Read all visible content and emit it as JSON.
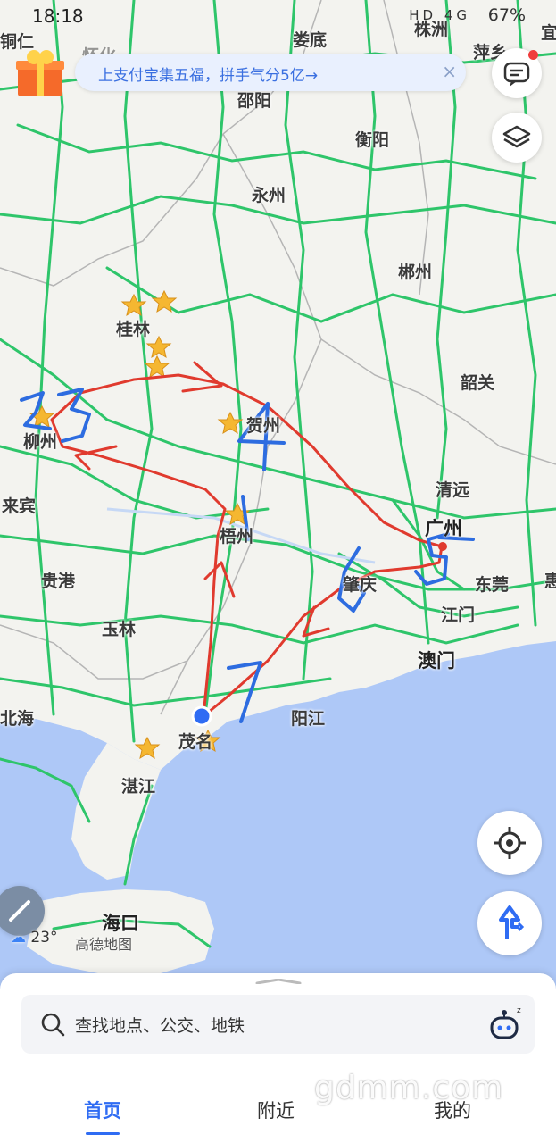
{
  "status_bar": {
    "time": "18:18",
    "network": "HD  4G",
    "battery": "67%"
  },
  "banner": {
    "text": "上支付宝集五福，拼手气分5亿→",
    "close": "×"
  },
  "cities": [
    {
      "id": "tongren",
      "name": "铜仁"
    },
    {
      "id": "huaihua",
      "name": "怀化"
    },
    {
      "id": "loudi",
      "name": "娄底"
    },
    {
      "id": "zhuzhou",
      "name": "株洲"
    },
    {
      "id": "pingxiang",
      "name": "萍乡"
    },
    {
      "id": "yichun",
      "name": "宜"
    },
    {
      "id": "shaoyang",
      "name": "邵阳"
    },
    {
      "id": "hengyang",
      "name": "衡阳"
    },
    {
      "id": "yongzhou",
      "name": "永州"
    },
    {
      "id": "chenzhou",
      "name": "郴州"
    },
    {
      "id": "guilin",
      "name": "桂林"
    },
    {
      "id": "shaoguan",
      "name": "韶关"
    },
    {
      "id": "liuzhou",
      "name": "柳州"
    },
    {
      "id": "hezhou",
      "name": "贺州"
    },
    {
      "id": "qingyuan",
      "name": "清远"
    },
    {
      "id": "laibin",
      "name": "来宾"
    },
    {
      "id": "guangzhou",
      "name": "广州"
    },
    {
      "id": "wuzhou",
      "name": "梧州"
    },
    {
      "id": "zhaoqing",
      "name": "肇庆"
    },
    {
      "id": "dongguan",
      "name": "东莞"
    },
    {
      "id": "hui",
      "name": "惠"
    },
    {
      "id": "guigang",
      "name": "贵港"
    },
    {
      "id": "jiangmen",
      "name": "江门"
    },
    {
      "id": "yulin",
      "name": "玉林"
    },
    {
      "id": "macau",
      "name": "澳门"
    },
    {
      "id": "beihai",
      "name": "北海"
    },
    {
      "id": "yangjiang",
      "name": "阳江"
    },
    {
      "id": "maoming",
      "name": "茂名"
    },
    {
      "id": "zhanjiang",
      "name": "湛江"
    },
    {
      "id": "haikou",
      "name": "海口"
    }
  ],
  "annotations": [
    "1",
    "23",
    "4",
    "5",
    "6",
    "7"
  ],
  "weather": {
    "temp": "23°"
  },
  "brand": "高德地图",
  "search": {
    "placeholder": "查找地点、公交、地铁"
  },
  "tabs": [
    {
      "label": "首页",
      "active": true
    },
    {
      "label": "附近",
      "active": false
    },
    {
      "label": "我的",
      "active": false
    }
  ],
  "watermark": "gdmm.com",
  "icons": [
    "gift-icon",
    "message-icon",
    "layers-icon",
    "locate-icon",
    "navigate-icon",
    "search-icon",
    "assistant-icon",
    "weather-cloud-icon",
    "pen-icon"
  ],
  "colors": {
    "sea": "#aec8f7",
    "highway": "#2ec56a",
    "route": "#e03a2e",
    "pen": "#2d6ce0",
    "accent": "#2f6cf3"
  }
}
